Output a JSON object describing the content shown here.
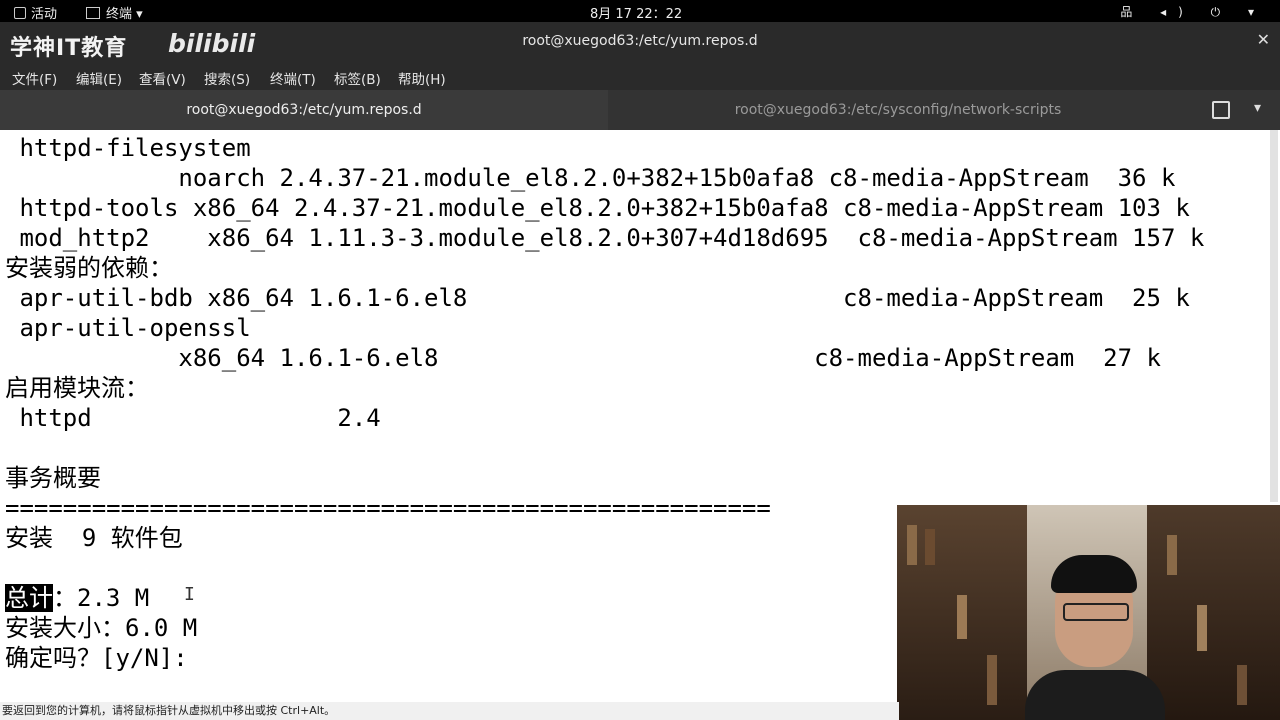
{
  "topbar": {
    "activities": "活动",
    "app_menu": "终端 ▾",
    "clock": "8月 17  22：22",
    "tray_icons": [
      "network-icon",
      "volume-icon",
      "power-icon"
    ],
    "tray_glyphs": "品 ◂) ⏻ ▾"
  },
  "window": {
    "brand": "学神IT教育",
    "watermark": "bilibili",
    "title": "root@xuegod63:/etc/yum.repos.d",
    "close_glyph": "✕"
  },
  "menubar": [
    {
      "label": "文件(F)"
    },
    {
      "label": "编辑(E)"
    },
    {
      "label": "查看(V)"
    },
    {
      "label": "搜索(S)"
    },
    {
      "label": "终端(T)"
    },
    {
      "label": "标签(B)"
    },
    {
      "label": "帮助(H)"
    }
  ],
  "tabs": [
    {
      "label": "root@xuegod63:/etc/yum.repos.d",
      "active": true
    },
    {
      "label": "root@xuegod63:/etc/sysconfig/network-scripts",
      "active": false
    }
  ],
  "terminal": {
    "lines": [
      " httpd-filesystem",
      "            noarch 2.4.37-21.module_el8.2.0+382+15b0afa8 c8-media-AppStream  36 k",
      " httpd-tools x86_64 2.4.37-21.module_el8.2.0+382+15b0afa8 c8-media-AppStream 103 k",
      " mod_http2    x86_64 1.11.3-3.module_el8.2.0+307+4d18d695  c8-media-AppStream 157 k",
      "安装弱的依赖：",
      " apr-util-bdb x86_64 1.6.1-6.el8                          c8-media-AppStream  25 k",
      " apr-util-openssl",
      "            x86_64 1.6.1-6.el8                          c8-media-AppStream  27 k",
      "启用模块流：",
      " httpd                 2.4",
      "",
      "事务概要",
      "=====================================================",
      "安装  9 软件包",
      ""
    ],
    "total_label": "总计",
    "total_value": "：2.3 M",
    "install_size": "安装大小：6.0 M",
    "confirm_prompt": "确定吗？[y/N]:",
    "cursor_glyph": "I"
  },
  "status_hint": "要返回到您的计算机，请将鼠标指针从虚拟机中移出或按 Ctrl+Alt。",
  "colors": {
    "topbar_bg": "#000000",
    "chrome_bg": "#2a2a2a",
    "terminal_bg": "#ffffff",
    "terminal_fg": "#000000"
  }
}
